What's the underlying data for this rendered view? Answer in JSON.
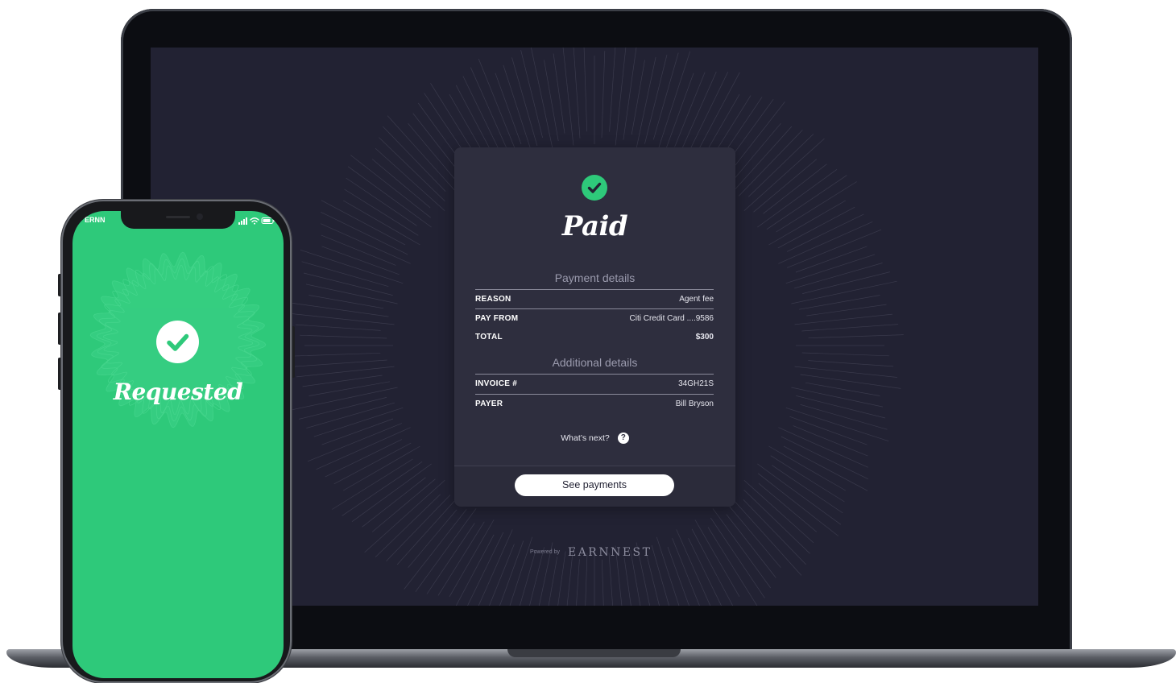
{
  "payment_card": {
    "status_title": "Paid",
    "payment_section_title": "Payment details",
    "payment_rows": [
      {
        "label": "REASON",
        "value": "Agent fee"
      },
      {
        "label": "PAY FROM",
        "value": "Citi Credit Card ....9586"
      },
      {
        "label": "TOTAL",
        "value": "$300"
      }
    ],
    "additional_section_title": "Additional details",
    "additional_rows": [
      {
        "label": "INVOICE #",
        "value": "34GH21S"
      },
      {
        "label": "PAYER",
        "value": "Bill Bryson"
      }
    ],
    "whats_next_label": "What’s next?",
    "help_icon_glyph": "?",
    "see_payments_label": "See payments"
  },
  "footer": {
    "powered_by": "Powered by",
    "brand": "EARNNEST"
  },
  "phone": {
    "carrier": "ERNN",
    "status_title": "Requested"
  },
  "icons": {
    "success": "check-circle-icon",
    "help": "question-circle-icon",
    "signal": "signal-icon",
    "wifi": "wifi-icon",
    "battery": "battery-icon"
  },
  "colors": {
    "accent_green": "#2ec97a",
    "screen_background": "#222233",
    "card_background": "#2e2e3e"
  }
}
